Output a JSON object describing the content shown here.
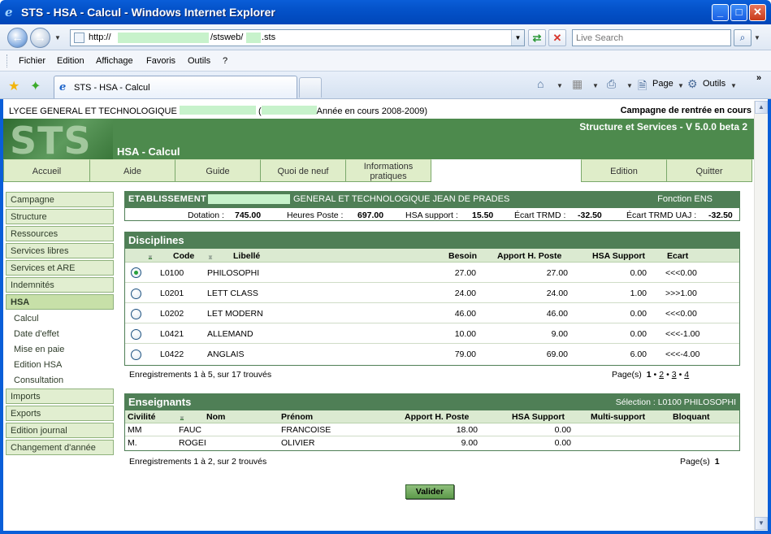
{
  "window": {
    "title": "STS - HSA - Calcul - Windows Internet Explorer",
    "min": "_",
    "max": "□",
    "close": "✕"
  },
  "address": {
    "prefix": "http://",
    "mid": "/stsweb/",
    "suffix": ".sts",
    "search_placeholder": "Live Search"
  },
  "menu": [
    "Fichier",
    "Edition",
    "Affichage",
    "Favoris",
    "Outils",
    "?"
  ],
  "tab": {
    "label": "STS - HSA - Calcul"
  },
  "commands": {
    "page": "Page",
    "tools": "Outils",
    "chevron": "»"
  },
  "header": {
    "school_left": "LYCEE GENERAL ET TECHNOLOGIQUE",
    "school_paren": "(",
    "year": "Année en cours 2008-2009)",
    "campagne": "Campagne de rentrée en cours",
    "app_version": "Structure et Services - V 5.0.0 beta 2",
    "app_title": "HSA - Calcul",
    "logo": "STS"
  },
  "nav_tabs": {
    "accueil": "Accueil",
    "aide": "Aide",
    "guide": "Guide",
    "quoi_de_neuf": "Quoi de neuf",
    "infos_line1": "Informations",
    "infos_line2": "pratiques",
    "edition": "Edition",
    "quitter": "Quitter"
  },
  "sidebar": {
    "campagne": "Campagne",
    "structure": "Structure",
    "ressources": "Ressources",
    "services_libres": "Services libres",
    "services_are": "Services et ARE",
    "indemnites": "Indemnités",
    "hsa": "HSA",
    "hsa_sub": [
      "Calcul",
      "Date d'effet",
      "Mise en paie",
      "Edition HSA",
      "Consultation"
    ],
    "imports": "Imports",
    "exports": "Exports",
    "edition_journal": "Edition journal",
    "changement_annee": "Changement d'année"
  },
  "etablissement": {
    "label": "ETABLISSEMENT",
    "name": "GENERAL ET TECHNOLOGIQUE JEAN DE PRADES",
    "fonction": "Fonction  ENS",
    "dotation_label": "Dotation :",
    "dotation": "745.00",
    "heures_label": "Heures Poste :",
    "heures": "697.00",
    "hsa_label": "HSA support :",
    "hsa": "15.50",
    "ecart_label": "Écart TRMD :",
    "ecart": "-32.50",
    "ecart_uaj_label": "Écart TRMD UAJ :",
    "ecart_uaj": "-32.50"
  },
  "disciplines": {
    "title": "Disciplines",
    "columns": {
      "code": "Code",
      "libelle": "Libellé",
      "besoin": "Besoin",
      "apport": "Apport H. Poste",
      "hsa": "HSA Support",
      "ecart": "Ecart"
    },
    "rows": [
      {
        "code": "L0100",
        "libelle": "PHILOSOPHI",
        "besoin": "27.00",
        "apport": "27.00",
        "hsa": "0.00",
        "ecart": "<<<0.00"
      },
      {
        "code": "L0201",
        "libelle": "LETT CLASS",
        "besoin": "24.00",
        "apport": "24.00",
        "hsa": "1.00",
        "ecart": ">>>1.00"
      },
      {
        "code": "L0202",
        "libelle": "LET MODERN",
        "besoin": "46.00",
        "apport": "46.00",
        "hsa": "0.00",
        "ecart": "<<<0.00"
      },
      {
        "code": "L0421",
        "libelle": "ALLEMAND",
        "besoin": "10.00",
        "apport": "9.00",
        "hsa": "0.00",
        "ecart": "<<<-1.00"
      },
      {
        "code": "L0422",
        "libelle": "ANGLAIS",
        "besoin": "79.00",
        "apport": "69.00",
        "hsa": "6.00",
        "ecart": "<<<-4.00"
      }
    ],
    "records": "Enregistrements 1 à 5, sur 17 trouvés",
    "pages_label": "Page(s)",
    "pages": [
      "1",
      "2",
      "3",
      "4"
    ],
    "bullet": "•"
  },
  "enseignants": {
    "title": "Enseignants",
    "selection": "Sélection : L0100 PHILOSOPHI",
    "columns": {
      "civilite": "Civilité",
      "nom": "Nom",
      "prenom": "Prénom",
      "apport": "Apport H. Poste",
      "hsa": "HSA Support",
      "multi": "Multi-support",
      "bloquant": "Bloquant"
    },
    "rows": [
      {
        "civilite": "MM",
        "nom": "FAUC",
        "prenom": "FRANCOISE",
        "apport": "18.00",
        "hsa": "0.00"
      },
      {
        "civilite": "M.",
        "nom": "ROGEI",
        "prenom": "OLIVIER",
        "apport": "9.00",
        "hsa": "0.00"
      }
    ],
    "records": "Enregistrements 1 à 2, sur 2 trouvés",
    "pages_label": "Page(s)",
    "page": "1"
  },
  "valider": "Valider"
}
